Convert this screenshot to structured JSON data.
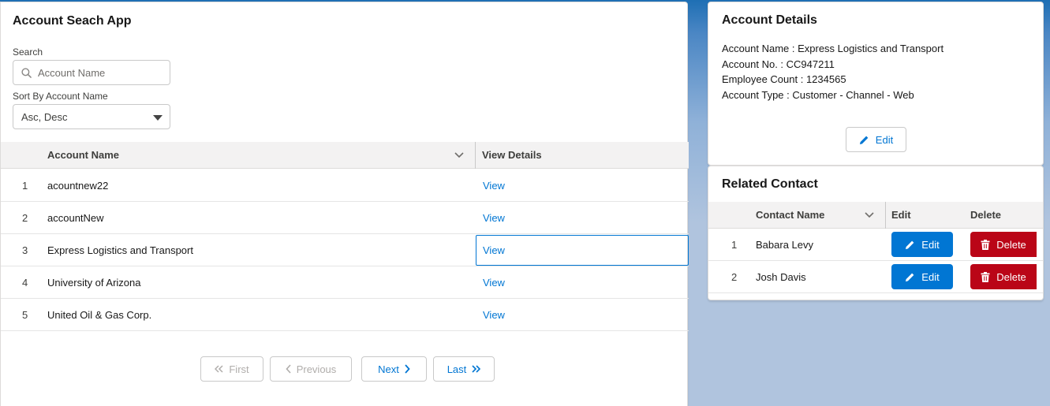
{
  "search_app": {
    "title": "Account Seach App",
    "search_label": "Search",
    "search_placeholder": "Account Name",
    "sort_label": "Sort By Account Name",
    "sort_value": "Asc, Desc",
    "columns": {
      "account_name": "Account Name",
      "view_details": "View Details"
    },
    "rows": [
      {
        "num": "1",
        "name": "acountnew22",
        "action": "View"
      },
      {
        "num": "2",
        "name": "accountNew",
        "action": "View"
      },
      {
        "num": "3",
        "name": "Express Logistics and Transport",
        "action": "View"
      },
      {
        "num": "4",
        "name": "University of Arizona",
        "action": "View"
      },
      {
        "num": "5",
        "name": "United Oil & Gas Corp.",
        "action": "View"
      }
    ],
    "pagination": {
      "first": "First",
      "previous": "Previous",
      "next": "Next",
      "last": "Last"
    }
  },
  "account_details": {
    "title": "Account Details",
    "lines": [
      "Account Name : Express Logistics and Transport",
      "Account No. : CC947211",
      "Employee Count : 1234565",
      "Account Type : Customer - Channel - Web"
    ],
    "edit_label": "Edit"
  },
  "related_contact": {
    "title": "Related Contact",
    "columns": {
      "contact_name": "Contact Name",
      "edit": "Edit",
      "delete": "Delete"
    },
    "rows": [
      {
        "num": "1",
        "name": "Babara Levy",
        "edit": "Edit",
        "delete": "Delete"
      },
      {
        "num": "2",
        "name": "Josh Davis",
        "edit": "Edit",
        "delete": "Delete"
      }
    ]
  },
  "colors": {
    "brand": "#0176d3",
    "destructive": "#ba0517",
    "header_bg": "#f3f2f2"
  }
}
